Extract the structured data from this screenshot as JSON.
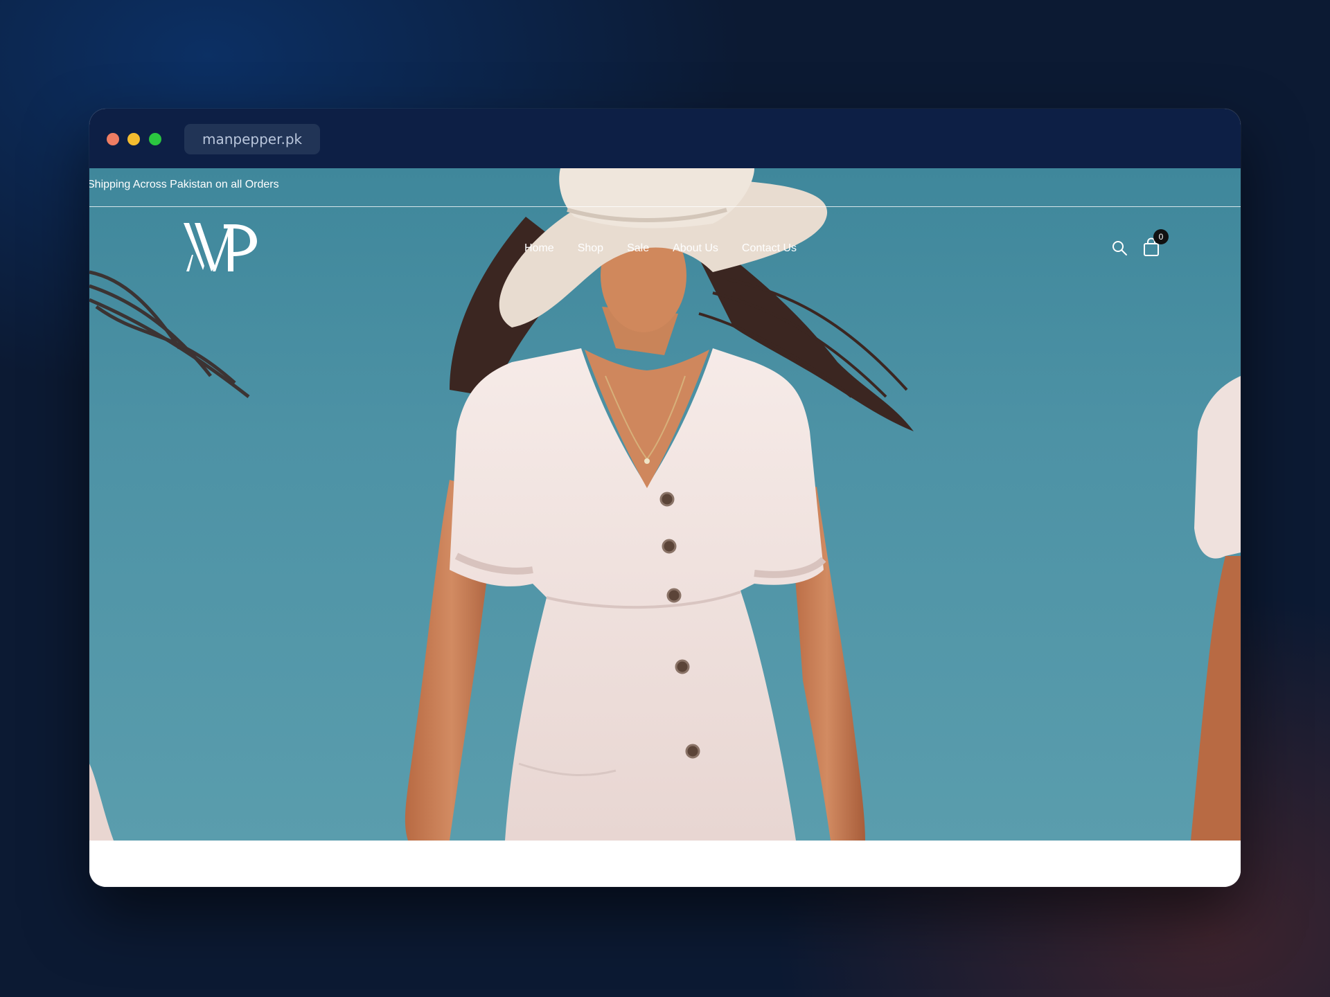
{
  "browser": {
    "url": "manpepper.pk",
    "traffic_lights": [
      "close",
      "minimize",
      "maximize"
    ]
  },
  "announcement": {
    "text": "Shipping Across Pakistan on all Orders"
  },
  "header": {
    "logo_text": "MP",
    "nav": [
      {
        "label": "Home"
      },
      {
        "label": "Shop"
      },
      {
        "label": "Sale"
      },
      {
        "label": "About Us"
      },
      {
        "label": "Contact Us"
      }
    ],
    "icons": [
      "search-icon",
      "shopping-bag-icon"
    ],
    "cart_count": "0"
  },
  "colors": {
    "sky": "#4d92a5",
    "titlebar": "#0d1f45",
    "dress": "#f3e6e3",
    "badge": "#111111"
  }
}
